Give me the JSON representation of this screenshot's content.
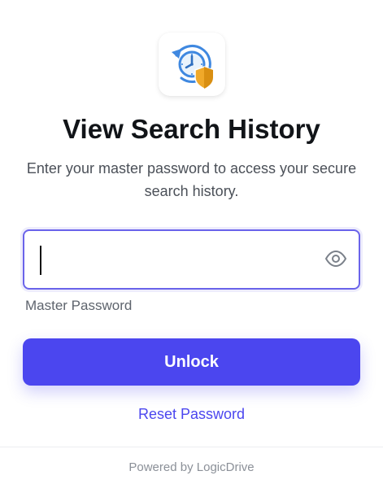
{
  "header": {
    "logo_icon": "history-clock-shield-icon",
    "title": "View Search History",
    "subtitle": "Enter your master password to access your secure search history."
  },
  "form": {
    "password_value": "",
    "password_label": "Master Password",
    "visibility_icon": "eye-icon",
    "unlock_label": "Unlock",
    "reset_label": "Reset Password"
  },
  "footer": {
    "text": "Powered by LogicDrive"
  },
  "colors": {
    "accent": "#4b46ef",
    "focus_border": "#6a63ea",
    "icon_blue": "#3f88e0",
    "shield_gold": "#f0a92a"
  }
}
